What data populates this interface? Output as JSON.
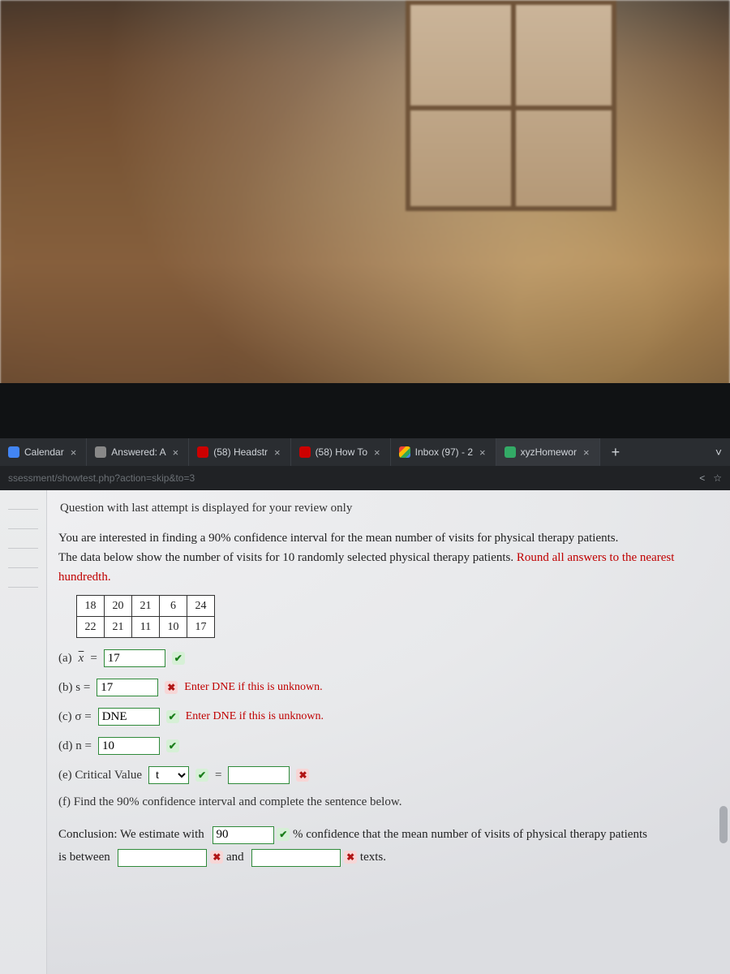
{
  "domain": "Computer-Use",
  "tabs": [
    {
      "label": "Calendar"
    },
    {
      "label": "Answered: A"
    },
    {
      "label": "(58) Headstr"
    },
    {
      "label": "(58) How To"
    },
    {
      "label": "Inbox (97) - 2"
    },
    {
      "label": "xyzHomewor"
    }
  ],
  "tabstrip": {
    "newtab": "+",
    "chevron": "˅"
  },
  "addressbar": {
    "path": "ssessment/showtest.php?action=skip&to=3",
    "share_icon": "<",
    "star_icon": "☆"
  },
  "notice": "Question with last attempt is displayed for your review only",
  "intro": {
    "line1": "You are interested in finding a 90% confidence interval for the mean number of visits for physical therapy patients.",
    "line2_a": "The data below show the number of visits for 10 randomly selected physical therapy patients. ",
    "line2_red": "Round all answers to the nearest hundredth."
  },
  "data_table": {
    "rows": [
      [
        "18",
        "20",
        "21",
        "6",
        "24"
      ],
      [
        "22",
        "21",
        "11",
        "10",
        "17"
      ]
    ]
  },
  "parts": {
    "a": {
      "label": "(a) ",
      "var": "x̄",
      "eq": " = ",
      "value": "17",
      "mark_type": "ok",
      "mark": "✔"
    },
    "b": {
      "label": "(b) s = ",
      "value": "17",
      "mark_type": "err",
      "mark": "✖",
      "hint": "Enter DNE if this is unknown."
    },
    "c": {
      "label": "(c) σ = ",
      "value": "DNE",
      "mark_type": "ok",
      "mark": "✔",
      "hint": "Enter DNE if this is unknown."
    },
    "d": {
      "label": "(d) n = ",
      "value": "10",
      "mark_type": "ok",
      "mark": "✔"
    },
    "e": {
      "label": "(e) Critical Value ",
      "dropdown_value": "t",
      "mark_dd_type": "ok",
      "mark_dd": "✔",
      "eq": " = ",
      "value": "",
      "mark_type": "err",
      "mark": "✖"
    },
    "f": {
      "label": "(f) Find the 90% confidence interval and complete the sentence below."
    }
  },
  "conclusion": {
    "pre": "Conclusion: We estimate with ",
    "conf_value": "90",
    "conf_mark_type": "ok",
    "conf_mark": "✔",
    "mid1": "% confidence that the mean number of visits of physical therapy patients",
    "mid2a": "is between ",
    "low_value": "",
    "low_mark_type": "err",
    "low_mark": "✖",
    "and": " and ",
    "high_value": "",
    "high_mark_type": "err",
    "high_mark": "✖",
    "tail": " texts."
  }
}
